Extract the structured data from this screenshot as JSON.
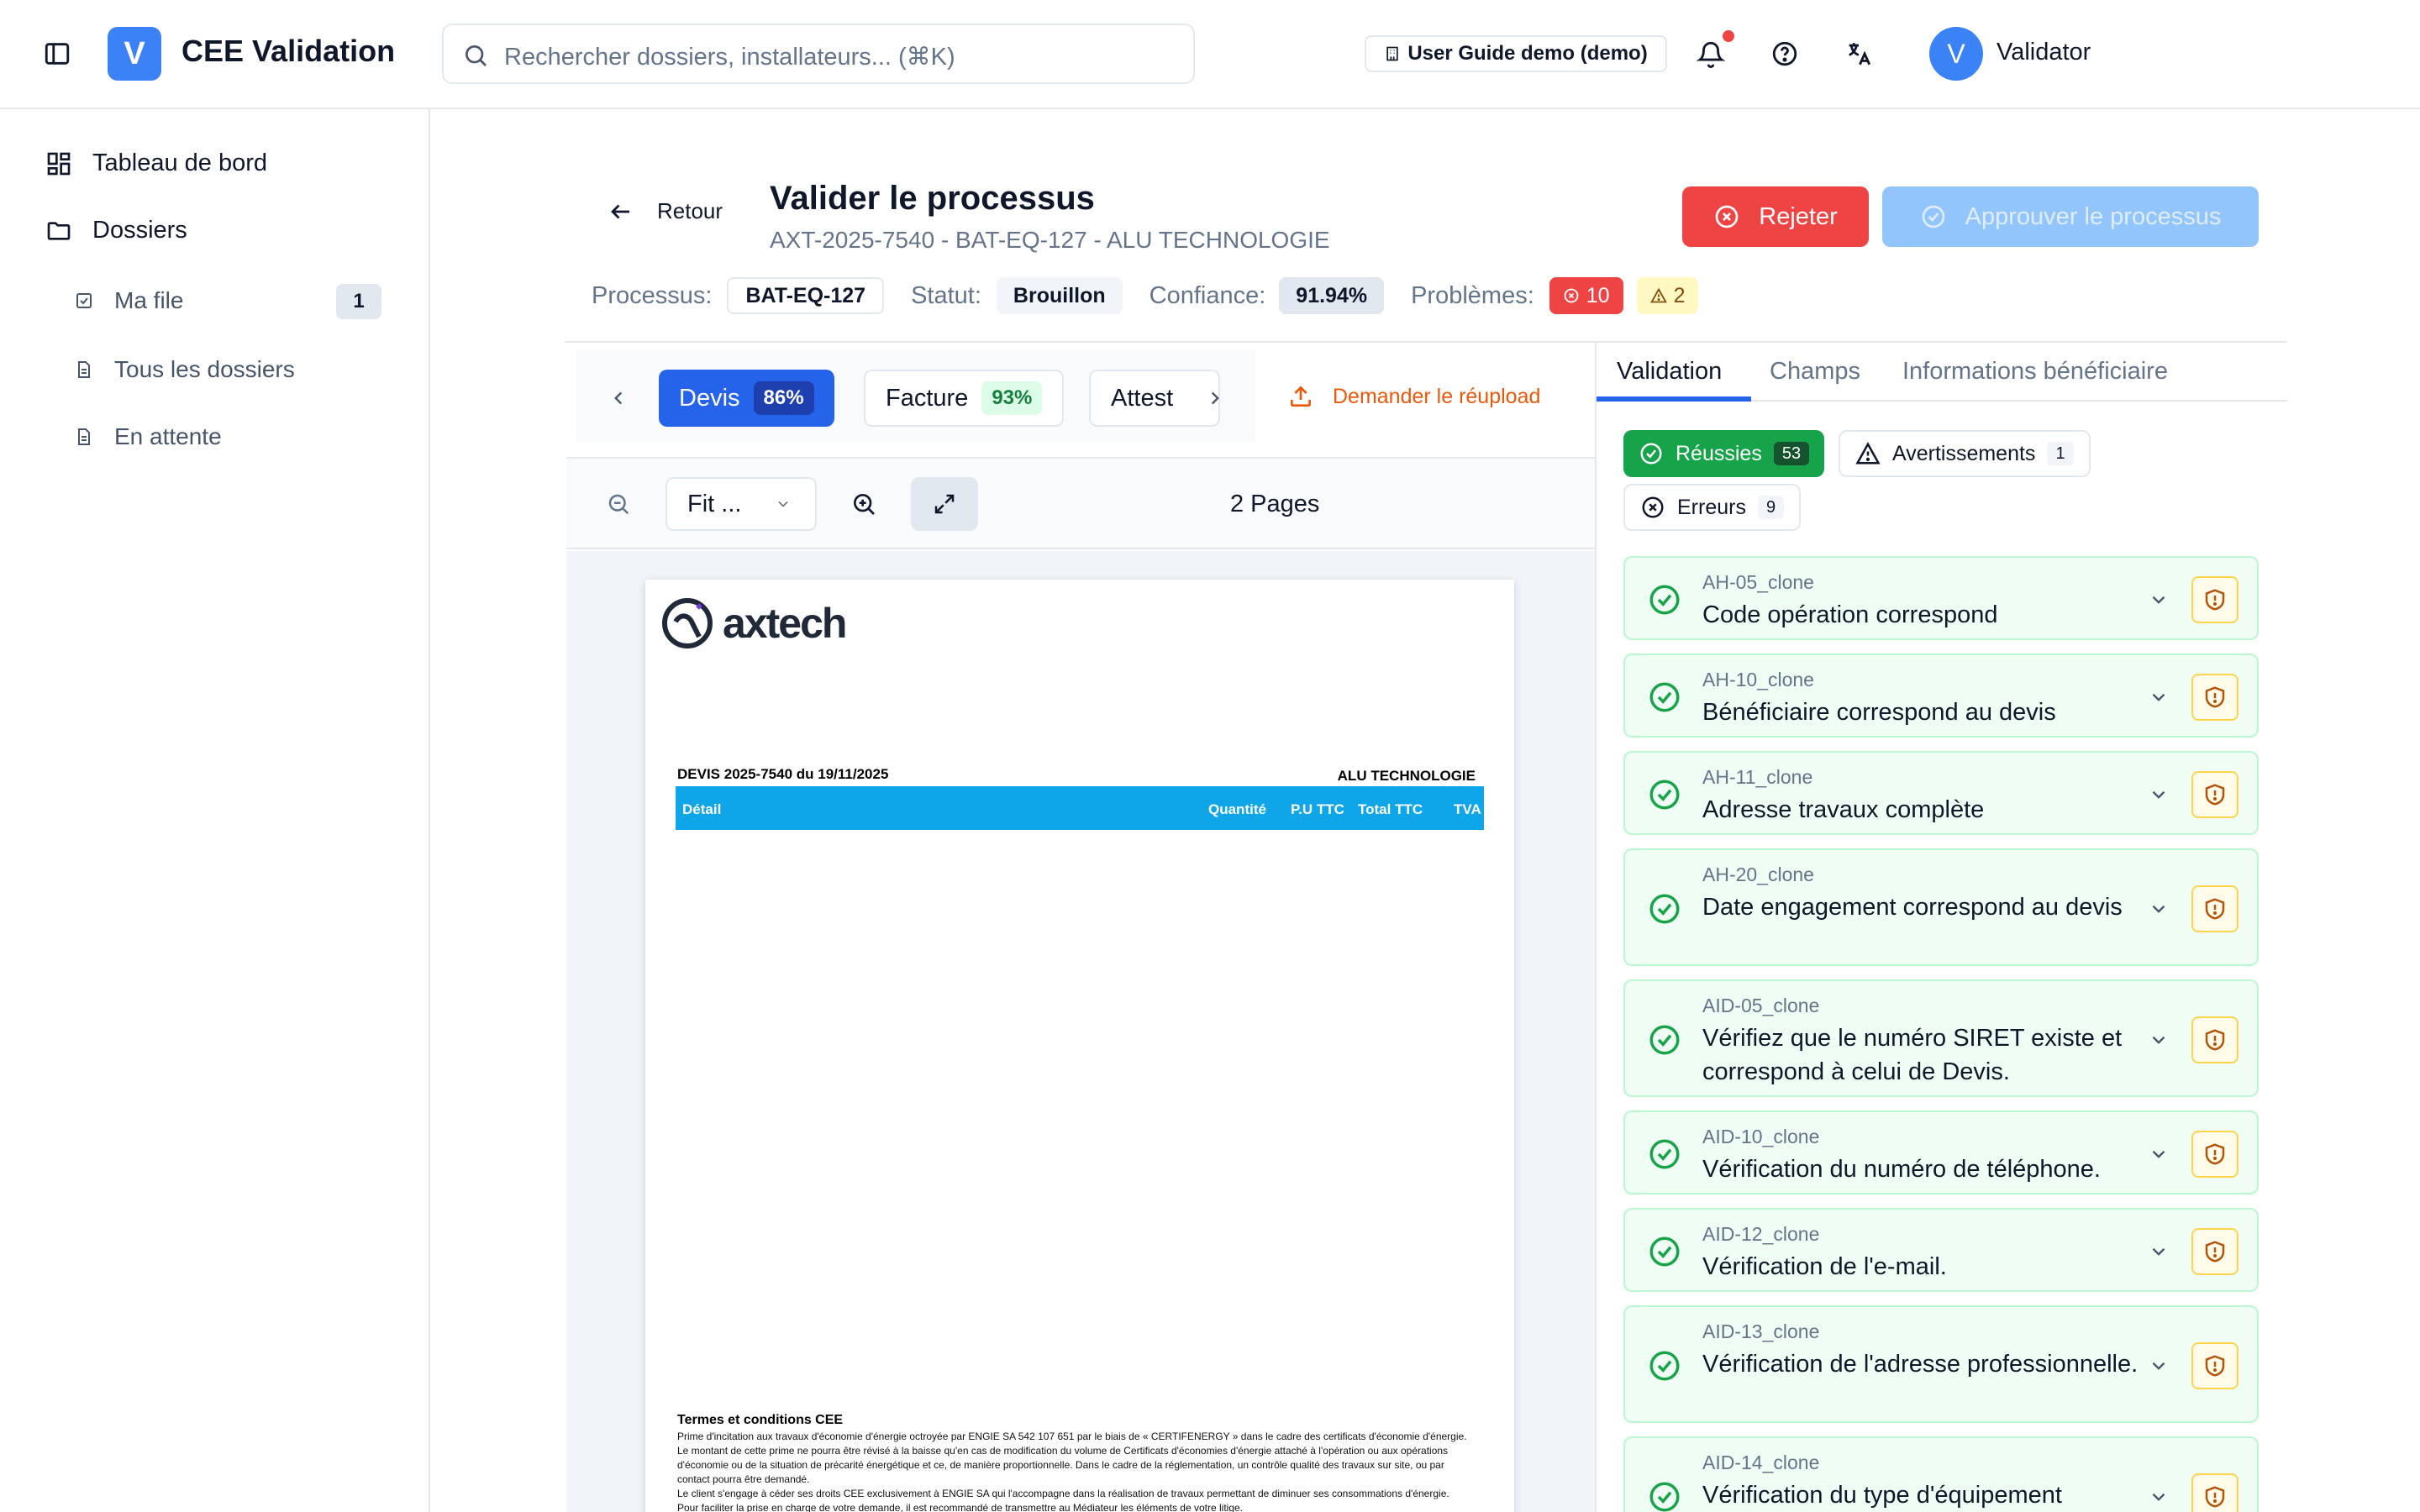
{
  "header": {
    "logo_letter": "V",
    "app_title": "CEE Validation",
    "search_placeholder": "Rechercher dossiers, installateurs... (⌘K)",
    "tenant_label": "User Guide demo (demo)",
    "user_initial": "V",
    "user_name": "Validator",
    "icons": [
      "sidebar-toggle-icon",
      "search-icon",
      "building-icon",
      "bell-icon",
      "help-icon",
      "translate-icon"
    ],
    "notification_dot_color": "#ef4444"
  },
  "sidebar": {
    "items": [
      {
        "label": "Tableau de bord",
        "icon": "dashboard-icon"
      },
      {
        "label": "Dossiers",
        "icon": "folder-icon"
      },
      {
        "label": "Ma file",
        "icon": "checkbox-icon",
        "count": "1"
      },
      {
        "label": "Tous les dossiers",
        "icon": "file-icon"
      },
      {
        "label": "En attente",
        "icon": "file-icon"
      }
    ]
  },
  "page": {
    "back_label": "Retour",
    "title": "Valider le processus",
    "subtitle": "AXT-2025-7540 - BAT-EQ-127 - ALU TECHNOLOGIE",
    "reject_label": "Rejeter",
    "approve_label": "Approuver le processus",
    "meta": {
      "process_label": "Processus:",
      "process_value": "BAT-EQ-127",
      "status_label": "Statut:",
      "status_value": "Brouillon",
      "confidence_label": "Confiance:",
      "confidence_value": "91.94%",
      "problems_label": "Problèmes:",
      "errors_count": "10",
      "warnings_count": "2"
    }
  },
  "documents": {
    "tabs": [
      {
        "label": "Devis",
        "pct": "86%",
        "active": true
      },
      {
        "label": "Facture",
        "pct": "93%",
        "active": false
      },
      {
        "label": "Attest",
        "pct": "",
        "active": false
      }
    ],
    "reupload_label": "Demander le réupload",
    "zoom_select": "Fit ...",
    "pages_label": "2 Pages"
  },
  "pdf": {
    "logo_text": "axtech",
    "devis_title": "DEVIS 2025-7540 du 19/11/2025",
    "client": "ALU TECHNOLOGIE",
    "columns": [
      "Détail",
      "Quantité",
      "P.U TTC",
      "Total TTC",
      "TVA"
    ],
    "terms_title": "Termes et conditions CEE",
    "terms_lines": [
      "Prime d'incitation aux travaux d'économie d'énergie octroyée par ENGIE SA 542 107 651 par le biais de « CERTIFENERGY » dans le cadre des certificats d'économie d'énergie.",
      "Le montant de cette prime ne pourra être révisé à la baisse qu'en cas de modification du volume de Certificats d'économies d'énergie attaché à l'opération ou aux opérations",
      "d'économie ou de la situation de précarité énergétique et ce, de manière proportionnelle. Dans le cadre de la réglementation, un contrôle qualité des travaux sur site, ou par",
      "contact pourra être demandé.",
      "Le client s'engage à céder ses droits CEE exclusivement à ENGIE SA qui l'accompagne dans la réalisation de travaux permettant de diminuer ses consommations d'énergie.",
      "Pour faciliter la prise en charge de votre demande, il est recommandé de transmettre au Médiateur les éléments de votre litige."
    ]
  },
  "validation": {
    "tabs": [
      "Validation",
      "Champs",
      "Informations bénéficiaire"
    ],
    "filters": [
      {
        "label": "Réussies",
        "count": "53"
      },
      {
        "label": "Avertissements",
        "count": "1"
      },
      {
        "label": "Erreurs",
        "count": "9"
      }
    ],
    "rules": [
      {
        "code": "AH-05_clone",
        "title": "Code opération correspond"
      },
      {
        "code": "AH-10_clone",
        "title": "Bénéficiaire correspond au devis"
      },
      {
        "code": "AH-11_clone",
        "title": "Adresse travaux complète"
      },
      {
        "code": "AH-20_clone",
        "title": "Date engagement correspond au devis"
      },
      {
        "code": "AID-05_clone",
        "title": "Vérifiez que le numéro SIRET existe et correspond à celui de Devis."
      },
      {
        "code": "AID-10_clone",
        "title": "Vérification du numéro de téléphone."
      },
      {
        "code": "AID-12_clone",
        "title": "Vérification de l'e-mail."
      },
      {
        "code": "AID-13_clone",
        "title": "Vérification de l'adresse professionnelle."
      },
      {
        "code": "AID-14_clone",
        "title": "Vérification du type d'équipement"
      }
    ]
  }
}
